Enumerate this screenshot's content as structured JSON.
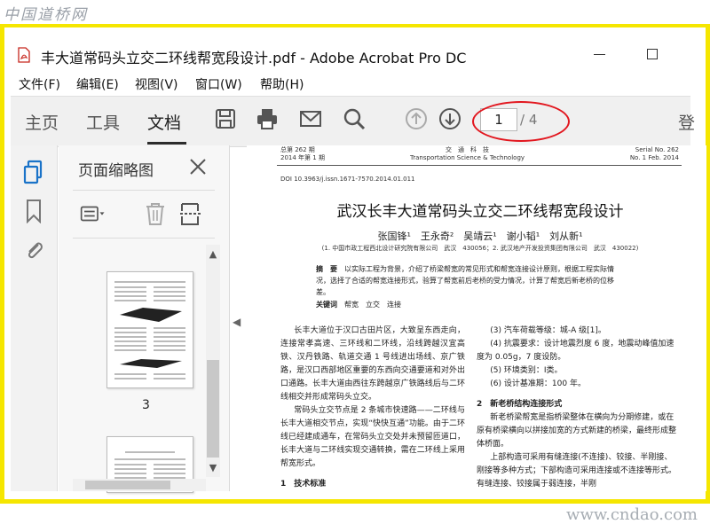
{
  "watermarks": {
    "top": "中国道桥网",
    "bottom": "www.cndao.com"
  },
  "window": {
    "title": "丰大道常码头立交二环线帮宽段设计.pdf - Adobe Acrobat Pro DC"
  },
  "menu": [
    "文件(F)",
    "编辑(E)",
    "视图(V)",
    "窗口(W)",
    "帮助(H)"
  ],
  "toolbar": {
    "tabs": [
      "主页",
      "工具",
      "文档"
    ],
    "active_tab": "文档",
    "current_page": "1",
    "page_total": "/ 4",
    "login_partial": "登",
    "icons": [
      "save-icon",
      "print-icon",
      "email-icon",
      "search-icon",
      "page-up-icon",
      "page-down-icon"
    ]
  },
  "left_rail": {
    "icons": [
      "page-thumbnails-icon",
      "bookmark-icon",
      "attachment-icon"
    ]
  },
  "thumb_panel": {
    "title": "页面缩略图",
    "tools": [
      "options-menu-icon",
      "delete-icon",
      "page-extract-icon"
    ],
    "thumb_label": "3"
  },
  "document": {
    "header_left": [
      "总第 262 期",
      "2014 年第 1 期"
    ],
    "header_center": [
      "交　通　科　技",
      "Transportation Science & Technology"
    ],
    "header_right": [
      "Serial No. 262",
      "No. 1 Feb. 2014"
    ],
    "doi": "DOI 10.3963/j.issn.1671-7570.2014.01.011",
    "title": "武汉长丰大道常码头立交二环线帮宽段设计",
    "authors": "张国锋¹　王永奇²　吴靖云¹　谢小韬¹　刘从新¹",
    "affiliation": "(1. 中国市政工程西北设计研究院有限公司　武汉　430056；2. 武汉地产开发投资集团有限公司　武汉　430022)",
    "abstract_label": "摘　要",
    "abstract": "以实际工程为背景，介绍了桥梁帮宽的常见形式和帮宽连接设计原则，根据工程实际情况，选择了合适的帮宽连接形式，验算了帮宽前后老桥的受力情况，计算了帮宽后新老桥的位移差。",
    "keywords_label": "关键词",
    "keywords": "帮宽　立交　连接",
    "col_left": [
      "长丰大道位于汉口古田片区，大致呈东西走向，连接常孝高速、三环线和二环线，沿线跨越汉宜高铁、汉丹铁路、轨道交通 1 号线进出场线、京广铁路，是汉口西部地区重要的东西向交通要道和对外出口通路。长丰大道由西往东跨越京广铁路线后与二环线相交并形成常码头立交。",
      "常码头立交节点是 2 条城市快速路——二环线与长丰大道相交节点，实现“快快互通”功能。由于二环线已经建成通车，在常码头立交处并未预留匝道口，长丰大道与二环线实现交通转换，需在二环线上采用帮宽形式。"
    ],
    "col_left_heading": "1　技术标准",
    "col_right": [
      "(3) 汽车荷载等级：城-A 级[1]。",
      "(4) 抗震要求：设计地震烈度 6 度，地震动峰值加速度为 0.05g，7 度设防。",
      "(5) 环境类别：Ⅰ类。",
      "(6) 设计基准期：100 年。"
    ],
    "col_right_heading": "2　新老桥结构连接形式",
    "col_right_body": [
      "新老桥梁帮宽是指桥梁整体在横向为分期修建，或在原有桥梁横向以拼接加宽的方式新建的桥梁，最终形成整体桥面。",
      "上部构造可采用有缝连接(不连接)、铰接、半刚接、刚接等多种方式；下部构造可采用连接或不连接等形式。有缝连接、铰接属于弱连接，半刚"
    ]
  },
  "colors": {
    "annotation_ellipse": "#e2161e",
    "frame_highlight": "#f5e600"
  }
}
